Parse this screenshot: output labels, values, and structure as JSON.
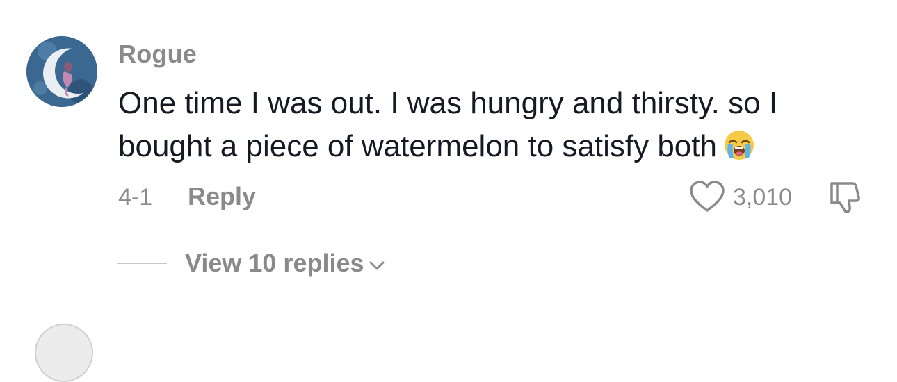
{
  "comment": {
    "username": "Rogue",
    "text": "One time I was out. I was hungry and thirsty. so I bought a piece of watermelon to satisfy both",
    "emoji_icon": "loudly-crying-face-emoji",
    "date": "4-1",
    "reply_label": "Reply",
    "like_count": "3,010",
    "like_icon": "heart-outline-icon",
    "dislike_icon": "thumbs-down-icon"
  },
  "replies": {
    "view_label": "View 10 replies",
    "chevron_icon": "chevron-down-icon"
  },
  "colors": {
    "text_primary": "#161823",
    "text_secondary": "#8a8a8a",
    "background": "#ffffff"
  }
}
